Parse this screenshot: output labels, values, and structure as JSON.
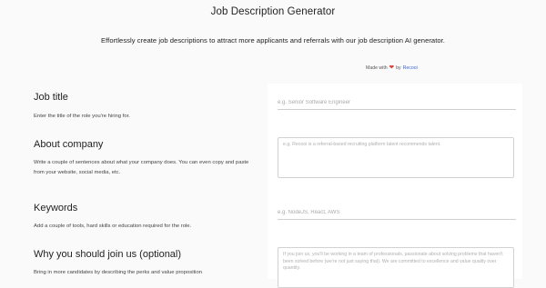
{
  "header": {
    "title": "Job Description Generator",
    "subtitle": "Effortlessly create job descriptions to attract more applicants and referrals with our job description AI generator."
  },
  "made_with": {
    "prefix": "Made with",
    "icon": "heart-icon",
    "by": "by",
    "brand": "Recooi"
  },
  "sections": {
    "job_title": {
      "title": "Job title",
      "description": "Enter the title of the role you're hiring for.",
      "placeholder": "e.g. Senior Software Engineer"
    },
    "about_company": {
      "title": "About company",
      "description": "Write a couple of sentences about what your company does. You can even copy and paste from your website, social media, etc.",
      "placeholder": "e.g. Recooi is a referral-based recruiting platform talent recommends talent."
    },
    "keywords": {
      "title": "Keywords",
      "description": "Add a couple of tools, hard skills or education required for the role.",
      "placeholder": "e.g. NodeJS, React, AWS"
    },
    "why_join": {
      "title": "Why you should join us (optional)",
      "description": "Bring in more candidates by describing the perks and value proposition",
      "placeholder": "If you join us, you'll be working in a team of professionals, passionate about solving problems that haven't been solved before (we're not just saying that). We are committed to excellence and value quality over quantity."
    }
  },
  "colors": {
    "heart": "#e23b3b",
    "brand_link": "#3a64d8",
    "background": "#fafafa"
  }
}
